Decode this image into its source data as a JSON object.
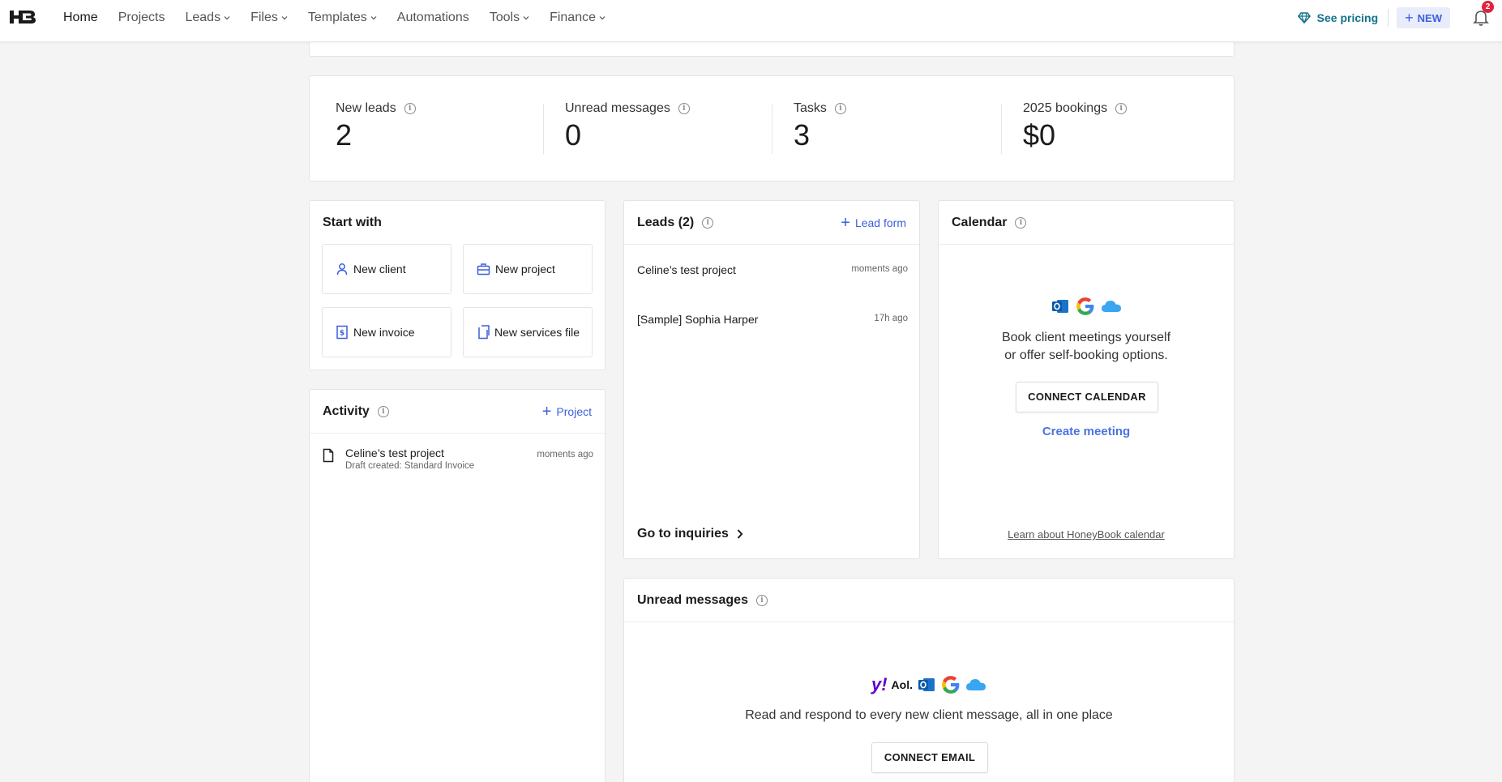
{
  "nav": {
    "items": [
      {
        "label": "Home",
        "active": true,
        "dropdown": false
      },
      {
        "label": "Projects",
        "active": false,
        "dropdown": false
      },
      {
        "label": "Leads",
        "active": false,
        "dropdown": true
      },
      {
        "label": "Files",
        "active": false,
        "dropdown": true
      },
      {
        "label": "Templates",
        "active": false,
        "dropdown": true
      },
      {
        "label": "Automations",
        "active": false,
        "dropdown": false
      },
      {
        "label": "Tools",
        "active": false,
        "dropdown": true
      },
      {
        "label": "Finance",
        "active": false,
        "dropdown": true
      }
    ],
    "see_pricing": "See pricing",
    "new_button": "NEW",
    "notifications_count": "2"
  },
  "stats": [
    {
      "label": "New leads",
      "value": "2"
    },
    {
      "label": "Unread messages",
      "value": "0"
    },
    {
      "label": "Tasks",
      "value": "3"
    },
    {
      "label": "2025 bookings",
      "value": "$0"
    }
  ],
  "start_with": {
    "title": "Start with",
    "buttons": [
      "New client",
      "New project",
      "New invoice",
      "New services file"
    ]
  },
  "activity": {
    "title": "Activity",
    "action": "Project",
    "items": [
      {
        "title": "Celine’s test project",
        "subtitle": "Draft created: Standard Invoice",
        "time": "moments ago"
      }
    ]
  },
  "leads": {
    "title": "Leads (2)",
    "action": "Lead form",
    "items": [
      {
        "name": "Celine’s test project",
        "time": "moments ago"
      },
      {
        "name": "[Sample] Sophia Harper",
        "time": "17h ago"
      }
    ],
    "footer": "Go to inquiries"
  },
  "calendar": {
    "title": "Calendar",
    "line1": "Book client meetings yourself",
    "line2": "or offer self-booking options.",
    "connect_button": "CONNECT CALENDAR",
    "create_meeting": "Create meeting",
    "learn_link": "Learn about HoneyBook calendar"
  },
  "unread": {
    "title": "Unread messages",
    "text": "Read and respond to every new client message, all in one place",
    "connect_button": "CONNECT EMAIL",
    "provider_yahoo": "y!",
    "provider_aol": "Aol."
  },
  "colors": {
    "accent": "#3c5fdc",
    "pricing": "#15728c",
    "badge": "#e0233d",
    "background": "#f4f4f5"
  }
}
